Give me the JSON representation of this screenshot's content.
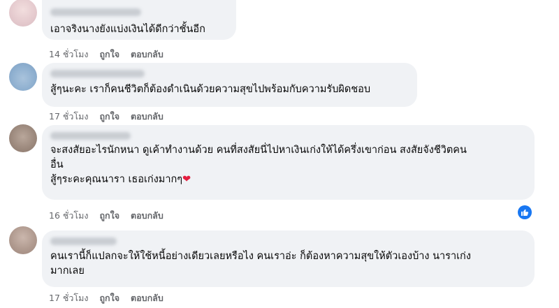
{
  "comments": [
    {
      "text": "เอาจริงนางยังแบ่งเงินได้ดีกว่าชั้นอีก",
      "time": "14 ชั่วโมง",
      "like": "ถูกใจ",
      "reply": "ตอบกลับ"
    },
    {
      "text": "สู้ๆนะคะ เราก็คนชีวิตก็ต้องดำเนินด้วยความสุขไปพร้อมกับความรับผิดชอบ",
      "time": "17 ชั่วโมง",
      "like": "ถูกใจ",
      "reply": "ตอบกลับ"
    },
    {
      "text_line1": "จะสงสัยอะไรนักหนา ดูเค้าทำงานด้วย คนที่สงสัยนี่ไปหาเงินเก่งให้ได้ครึ่งเขาก่อน สงสัยจังชีวิตคน",
      "text_line2": "อื่น",
      "text_line3": "สู้ๆระคะคุณนารา เธอเก่งมากๆ",
      "heart": "❤",
      "time": "16 ชั่วโมง",
      "like": "ถูกใจ",
      "reply": "ตอบกลับ",
      "reaction_icon": "thumbs-up-icon",
      "reaction_color": "#1877f2"
    },
    {
      "text_line1": "คนเรานี้ก็แปลกจะให้ใช้หนี้อย่างเดียวเลยหรือไง คนเราอ่ะ ก็ต้องหาความสุขให้ตัวเองบ้าง นาราเก่ง",
      "text_line2": "มากเลย",
      "time": "17 ชั่วโมง",
      "like": "ถูกใจ",
      "reply": "ตอบกลับ"
    }
  ],
  "colors": {
    "bubble": "#f0f2f5",
    "meta": "#65676b",
    "heart": "#e41e3f"
  }
}
